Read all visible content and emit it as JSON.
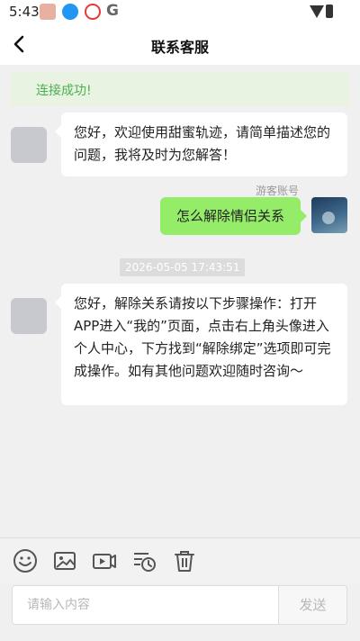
{
  "status_bar": {
    "time": "5:43",
    "icons": [
      "photo-app-icon",
      "download-icon",
      "shopping-app-icon",
      "google-icon",
      "wifi-icon",
      "battery-icon"
    ],
    "google_glyph": "G"
  },
  "header": {
    "title": "联系客服",
    "back_icon": "chevron-left-icon"
  },
  "connection": {
    "status_text": "连接成功!",
    "color": "#4caf50"
  },
  "messages": [
    {
      "from": "agent",
      "text": "您好，欢迎使用甜蜜轨迹，请简单描述您的问题，我将及时为您解答！"
    },
    {
      "from": "user",
      "sender_label": "游客账号",
      "text": "怎么解除情侣关系"
    },
    {
      "type": "timestamp",
      "text": "2026-05-05 17:43:51"
    },
    {
      "from": "agent",
      "text": "您好，解除关系请按以下步骤操作：打开APP进入“我的”页面，点击右上角头像进入个人中心，下方找到“解除绑定”选项即可完成操作。如有其他问题欢迎随时咨询～"
    }
  ],
  "toolbar": {
    "icons": [
      "emoji-icon",
      "image-icon",
      "video-icon",
      "history-icon",
      "trash-icon"
    ]
  },
  "composer": {
    "placeholder": "请输入内容",
    "value": "",
    "send_label": "发送"
  },
  "colors": {
    "user_bubble": "#95ec69",
    "agent_bubble": "#ffffff",
    "background": "#f0f0f0",
    "banner": "#e8f3e1"
  }
}
